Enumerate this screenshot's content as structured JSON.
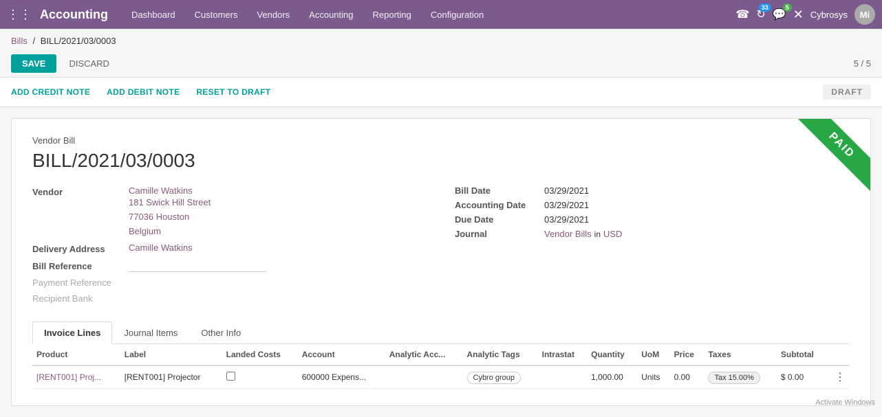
{
  "topnav": {
    "brand": "Accounting",
    "menu_items": [
      "Dashboard",
      "Customers",
      "Vendors",
      "Accounting",
      "Reporting",
      "Configuration"
    ],
    "badge_33": "33",
    "badge_5": "5",
    "username": "Cybrosys",
    "avatar_initials": "Mi"
  },
  "breadcrumb": {
    "parent": "Bills",
    "current": "BILL/2021/03/0003"
  },
  "actions": {
    "save": "SAVE",
    "discard": "DISCARD",
    "page_nav": "5 / 5"
  },
  "secondary": {
    "add_credit_note": "ADD CREDIT NOTE",
    "add_debit_note": "ADD DEBIT NOTE",
    "reset_to_draft": "RESET TO DRAFT",
    "draft_label": "DRAFT"
  },
  "document": {
    "type_label": "Vendor Bill",
    "bill_number": "BILL/2021/03/0003",
    "paid_stamp": "PAID",
    "vendor_label": "Vendor",
    "vendor_name": "Camille Watkins",
    "vendor_address_1": "181 Swick Hill Street",
    "vendor_address_2": "77036 Houston",
    "vendor_address_3": "Belgium",
    "delivery_label": "Delivery Address",
    "delivery_name": "Camille Watkins",
    "bill_ref_label": "Bill Reference",
    "payment_ref_label": "Payment Reference",
    "recipient_bank_label": "Recipient Bank",
    "bill_date_label": "Bill Date",
    "bill_date": "03/29/2021",
    "accounting_date_label": "Accounting Date",
    "accounting_date": "03/29/2021",
    "due_date_label": "Due Date",
    "due_date": "03/29/2021",
    "journal_label": "Journal",
    "journal_name": "Vendor Bills",
    "journal_in": "in",
    "currency": "USD"
  },
  "tabs": [
    {
      "label": "Invoice Lines",
      "active": true
    },
    {
      "label": "Journal Items",
      "active": false
    },
    {
      "label": "Other Info",
      "active": false
    }
  ],
  "table": {
    "headers": [
      "Product",
      "Label",
      "Landed Costs",
      "Account",
      "Analytic Acc...",
      "Analytic Tags",
      "Intrastat",
      "Quantity",
      "UoM",
      "Price",
      "Taxes",
      "Subtotal",
      ""
    ],
    "rows": [
      {
        "product": "[RENT001] Proj...",
        "label": "[RENT001] Projector",
        "landed_costs": false,
        "account": "600000 Expens...",
        "analytic_acc": "",
        "analytic_tags": "Cybro group",
        "intrastat": "",
        "quantity": "1,000.00",
        "uom": "Units",
        "price": "0.00",
        "taxes": "Tax 15.00%",
        "subtotal": "$ 0.00"
      }
    ]
  },
  "watermark": "Activate Windows"
}
